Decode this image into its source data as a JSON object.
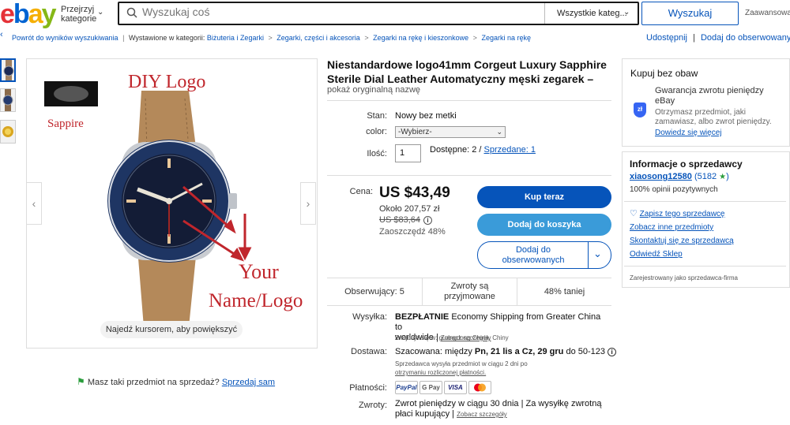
{
  "header": {
    "browse_line1": "Przejrzyj",
    "browse_line2": "kategorie",
    "search_placeholder": "Wyszukaj coś",
    "category_select": "Wszystkie kateg...",
    "search_button": "Wyszukaj",
    "advanced": "Zaawansowane"
  },
  "breadcrumb": {
    "back": "Powrót do wyników wyszukiwania",
    "listed_in": "Wystawione w kategorii:",
    "items": [
      "Biżuteria i Zegarki",
      "Zegarki, części i akcesoria",
      "Zegarki na rękę i kieszonkowe",
      "Zegarki na rękę"
    ],
    "share": "Udostępnij",
    "watch": "Dodaj do obserwowanych"
  },
  "gallery": {
    "zoom_hint": "Najedź kursorem, aby powiększyć",
    "image_texts": {
      "diy": "DIY Logo",
      "sapphire": "Sappire",
      "your": "Your",
      "name_logo": "Name/Logo"
    }
  },
  "sell_prompt": {
    "text": "Masz taki przedmiot na sprzedaż?",
    "link": "Sprzedaj sam"
  },
  "listing": {
    "title": "Niestandardowe logo41mm Corgeut Luxury Sapphire Sterile Dial Leather Automatyczny męski zegarek –",
    "original_name_link": "pokaż oryginalną nazwę",
    "condition_label": "Stan:",
    "condition_value": "Nowy bez metki",
    "color_label": "color:",
    "color_value": "-Wybierz-",
    "qty_label": "Ilość:",
    "qty_value": "1",
    "available": "Dostępne: 2 /",
    "sold_link": "Sprzedane: 1",
    "price_label": "Cena:",
    "price": "US $43,49",
    "approx": "Około 207,57 zł",
    "original_price": "US $83,64",
    "savings": "Zaoszczędź 48%",
    "buy_now": "Kup teraz",
    "add_to_cart": "Dodaj do koszyka",
    "watch_line1": "Dodaj do",
    "watch_line2": "obserwowanych"
  },
  "stats": {
    "watchers": "Obserwujący: 5",
    "returns_line1": "Zwroty są",
    "returns_line2": "przyjmowane",
    "cheaper": "48% taniej"
  },
  "shipping": {
    "label": "Wysyłka:",
    "free": "BEZPŁATNIE",
    "method": "Economy Shipping from Greater China to",
    "method2": "worldwide",
    "details_link": "Zobacz szczegóły",
    "location": "Znajduje się w: guangdong China, Chiny"
  },
  "delivery": {
    "label": "Dostawa:",
    "estimate_prefix": "Szacowana: między",
    "estimate_bold": "Pn, 21 lis a Cz, 29 gru",
    "estimate_suffix": "do 50-123",
    "note": "Sprzedawca wysyła przedmiot w ciągu 2 dni po",
    "note_link": "otrzymaniu rozliczonej płatności."
  },
  "payments": {
    "label": "Płatności:",
    "methods": [
      "PayPal",
      "G Pay",
      "VISA",
      "MC"
    ]
  },
  "returns": {
    "label": "Zwroty:",
    "line1": "Zwrot pieniędzy w ciągu 30 dnia | Za wysyłkę zwrotną",
    "line2": "płaci kupujący",
    "details_link": "Zobacz szczegóły"
  },
  "buyer_protection": {
    "title": "Kupuj bez obaw",
    "shield": "zł",
    "line1": "Gwarancja zwrotu pieniędzy",
    "line2": "eBay",
    "desc1": "Otrzymasz przedmiot, jaki",
    "desc2": "zamawiasz, albo zwrot pieniędzy.",
    "more_link": "Dowiedz się więcej"
  },
  "seller": {
    "title": "Informacje o sprzedawcy",
    "name": "xiaosong12580",
    "score": "(5182",
    "score_close": ")",
    "positive": "100% opinii pozytywnych",
    "save_seller": "Zapisz tego sprzedawcę",
    "other_items": "Zobacz inne przedmioty",
    "contact": "Skontaktuj się ze sprzedawcą",
    "visit_store": "Odwiedź Sklep",
    "registered": "Zarejestrowany jako sprzedawca-firma"
  },
  "colors": {
    "primary_blue": "#0654ba",
    "cart_blue": "#3a9bd9",
    "diy_red": "#c0262c"
  }
}
